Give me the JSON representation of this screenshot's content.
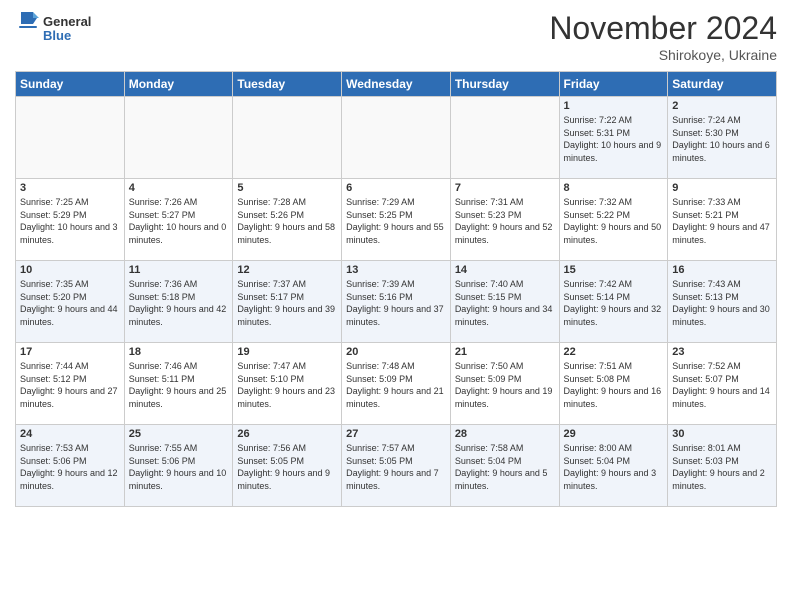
{
  "header": {
    "logo_general": "General",
    "logo_blue": "Blue",
    "month_title": "November 2024",
    "subtitle": "Shirokoye, Ukraine"
  },
  "weekdays": [
    "Sunday",
    "Monday",
    "Tuesday",
    "Wednesday",
    "Thursday",
    "Friday",
    "Saturday"
  ],
  "weeks": [
    [
      {
        "day": "",
        "sunrise": "",
        "sunset": "",
        "daylight": ""
      },
      {
        "day": "",
        "sunrise": "",
        "sunset": "",
        "daylight": ""
      },
      {
        "day": "",
        "sunrise": "",
        "sunset": "",
        "daylight": ""
      },
      {
        "day": "",
        "sunrise": "",
        "sunset": "",
        "daylight": ""
      },
      {
        "day": "",
        "sunrise": "",
        "sunset": "",
        "daylight": ""
      },
      {
        "day": "1",
        "sunrise": "Sunrise: 7:22 AM",
        "sunset": "Sunset: 5:31 PM",
        "daylight": "Daylight: 10 hours and 9 minutes."
      },
      {
        "day": "2",
        "sunrise": "Sunrise: 7:24 AM",
        "sunset": "Sunset: 5:30 PM",
        "daylight": "Daylight: 10 hours and 6 minutes."
      }
    ],
    [
      {
        "day": "3",
        "sunrise": "Sunrise: 7:25 AM",
        "sunset": "Sunset: 5:29 PM",
        "daylight": "Daylight: 10 hours and 3 minutes."
      },
      {
        "day": "4",
        "sunrise": "Sunrise: 7:26 AM",
        "sunset": "Sunset: 5:27 PM",
        "daylight": "Daylight: 10 hours and 0 minutes."
      },
      {
        "day": "5",
        "sunrise": "Sunrise: 7:28 AM",
        "sunset": "Sunset: 5:26 PM",
        "daylight": "Daylight: 9 hours and 58 minutes."
      },
      {
        "day": "6",
        "sunrise": "Sunrise: 7:29 AM",
        "sunset": "Sunset: 5:25 PM",
        "daylight": "Daylight: 9 hours and 55 minutes."
      },
      {
        "day": "7",
        "sunrise": "Sunrise: 7:31 AM",
        "sunset": "Sunset: 5:23 PM",
        "daylight": "Daylight: 9 hours and 52 minutes."
      },
      {
        "day": "8",
        "sunrise": "Sunrise: 7:32 AM",
        "sunset": "Sunset: 5:22 PM",
        "daylight": "Daylight: 9 hours and 50 minutes."
      },
      {
        "day": "9",
        "sunrise": "Sunrise: 7:33 AM",
        "sunset": "Sunset: 5:21 PM",
        "daylight": "Daylight: 9 hours and 47 minutes."
      }
    ],
    [
      {
        "day": "10",
        "sunrise": "Sunrise: 7:35 AM",
        "sunset": "Sunset: 5:20 PM",
        "daylight": "Daylight: 9 hours and 44 minutes."
      },
      {
        "day": "11",
        "sunrise": "Sunrise: 7:36 AM",
        "sunset": "Sunset: 5:18 PM",
        "daylight": "Daylight: 9 hours and 42 minutes."
      },
      {
        "day": "12",
        "sunrise": "Sunrise: 7:37 AM",
        "sunset": "Sunset: 5:17 PM",
        "daylight": "Daylight: 9 hours and 39 minutes."
      },
      {
        "day": "13",
        "sunrise": "Sunrise: 7:39 AM",
        "sunset": "Sunset: 5:16 PM",
        "daylight": "Daylight: 9 hours and 37 minutes."
      },
      {
        "day": "14",
        "sunrise": "Sunrise: 7:40 AM",
        "sunset": "Sunset: 5:15 PM",
        "daylight": "Daylight: 9 hours and 34 minutes."
      },
      {
        "day": "15",
        "sunrise": "Sunrise: 7:42 AM",
        "sunset": "Sunset: 5:14 PM",
        "daylight": "Daylight: 9 hours and 32 minutes."
      },
      {
        "day": "16",
        "sunrise": "Sunrise: 7:43 AM",
        "sunset": "Sunset: 5:13 PM",
        "daylight": "Daylight: 9 hours and 30 minutes."
      }
    ],
    [
      {
        "day": "17",
        "sunrise": "Sunrise: 7:44 AM",
        "sunset": "Sunset: 5:12 PM",
        "daylight": "Daylight: 9 hours and 27 minutes."
      },
      {
        "day": "18",
        "sunrise": "Sunrise: 7:46 AM",
        "sunset": "Sunset: 5:11 PM",
        "daylight": "Daylight: 9 hours and 25 minutes."
      },
      {
        "day": "19",
        "sunrise": "Sunrise: 7:47 AM",
        "sunset": "Sunset: 5:10 PM",
        "daylight": "Daylight: 9 hours and 23 minutes."
      },
      {
        "day": "20",
        "sunrise": "Sunrise: 7:48 AM",
        "sunset": "Sunset: 5:09 PM",
        "daylight": "Daylight: 9 hours and 21 minutes."
      },
      {
        "day": "21",
        "sunrise": "Sunrise: 7:50 AM",
        "sunset": "Sunset: 5:09 PM",
        "daylight": "Daylight: 9 hours and 19 minutes."
      },
      {
        "day": "22",
        "sunrise": "Sunrise: 7:51 AM",
        "sunset": "Sunset: 5:08 PM",
        "daylight": "Daylight: 9 hours and 16 minutes."
      },
      {
        "day": "23",
        "sunrise": "Sunrise: 7:52 AM",
        "sunset": "Sunset: 5:07 PM",
        "daylight": "Daylight: 9 hours and 14 minutes."
      }
    ],
    [
      {
        "day": "24",
        "sunrise": "Sunrise: 7:53 AM",
        "sunset": "Sunset: 5:06 PM",
        "daylight": "Daylight: 9 hours and 12 minutes."
      },
      {
        "day": "25",
        "sunrise": "Sunrise: 7:55 AM",
        "sunset": "Sunset: 5:06 PM",
        "daylight": "Daylight: 9 hours and 10 minutes."
      },
      {
        "day": "26",
        "sunrise": "Sunrise: 7:56 AM",
        "sunset": "Sunset: 5:05 PM",
        "daylight": "Daylight: 9 hours and 9 minutes."
      },
      {
        "day": "27",
        "sunrise": "Sunrise: 7:57 AM",
        "sunset": "Sunset: 5:05 PM",
        "daylight": "Daylight: 9 hours and 7 minutes."
      },
      {
        "day": "28",
        "sunrise": "Sunrise: 7:58 AM",
        "sunset": "Sunset: 5:04 PM",
        "daylight": "Daylight: 9 hours and 5 minutes."
      },
      {
        "day": "29",
        "sunrise": "Sunrise: 8:00 AM",
        "sunset": "Sunset: 5:04 PM",
        "daylight": "Daylight: 9 hours and 3 minutes."
      },
      {
        "day": "30",
        "sunrise": "Sunrise: 8:01 AM",
        "sunset": "Sunset: 5:03 PM",
        "daylight": "Daylight: 9 hours and 2 minutes."
      }
    ]
  ]
}
